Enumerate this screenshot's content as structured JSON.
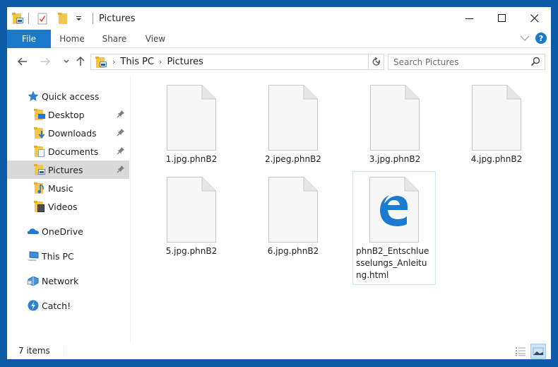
{
  "window": {
    "title": "Pictures",
    "controls": {
      "minimize_icon": "minimize-icon",
      "maximize_icon": "maximize-icon",
      "close_icon": "close-icon"
    }
  },
  "quick_access_toolbar": {
    "icons": [
      "folder-pictures-icon",
      "properties-icon",
      "new-folder-icon",
      "customize-dropdown-icon"
    ]
  },
  "ribbon": {
    "tabs": [
      {
        "label": "File",
        "active": true
      },
      {
        "label": "Home"
      },
      {
        "label": "Share"
      },
      {
        "label": "View"
      }
    ],
    "expand_icon": "chevron-down-icon",
    "help_label": "?"
  },
  "navigation": {
    "back_icon": "arrow-left-icon",
    "forward_icon": "arrow-right-icon",
    "recent_icon": "chevron-down-icon",
    "up_icon": "arrow-up-icon",
    "breadcrumb": [
      "This PC",
      "Pictures"
    ],
    "refresh_icon": "refresh-icon",
    "search_placeholder": "Search Pictures"
  },
  "sidebar": {
    "items": [
      {
        "label": "Quick access",
        "icon": "star-icon"
      },
      {
        "label": "Desktop",
        "icon": "desktop-folder-icon",
        "pinned": true
      },
      {
        "label": "Downloads",
        "icon": "downloads-folder-icon",
        "pinned": true
      },
      {
        "label": "Documents",
        "icon": "documents-folder-icon",
        "pinned": true
      },
      {
        "label": "Pictures",
        "icon": "pictures-folder-icon",
        "pinned": true,
        "selected": true
      },
      {
        "label": "Music",
        "icon": "music-folder-icon"
      },
      {
        "label": "Videos",
        "icon": "videos-folder-icon"
      },
      {
        "label": "OneDrive",
        "icon": "cloud-icon"
      },
      {
        "label": "This PC",
        "icon": "computer-icon"
      },
      {
        "label": "Network",
        "icon": "network-icon"
      },
      {
        "label": "Catch!",
        "icon": "catch-icon"
      }
    ]
  },
  "files": [
    {
      "name": "1.jpg.phnB2",
      "type": "blank"
    },
    {
      "name": "2.jpeg.phnB2",
      "type": "blank"
    },
    {
      "name": "3.jpg.phnB2",
      "type": "blank"
    },
    {
      "name": "4.jpg.phnB2",
      "type": "blank"
    },
    {
      "name": "5.jpg.phnB2",
      "type": "blank"
    },
    {
      "name": "6.jpg.phnB2",
      "type": "blank"
    },
    {
      "name": "phnB2_Entschluesselungs_Anleitung.html",
      "type": "edge-html",
      "selected": true
    }
  ],
  "status": {
    "item_count": "7 items",
    "views": [
      "details-view",
      "large-icons-view"
    ],
    "active_view": "large-icons-view"
  },
  "colors": {
    "accent": "#1979ca",
    "frame": "#0d5aa7",
    "selection": "#d9d9d9",
    "edge_blue": "#1a7bd0"
  }
}
